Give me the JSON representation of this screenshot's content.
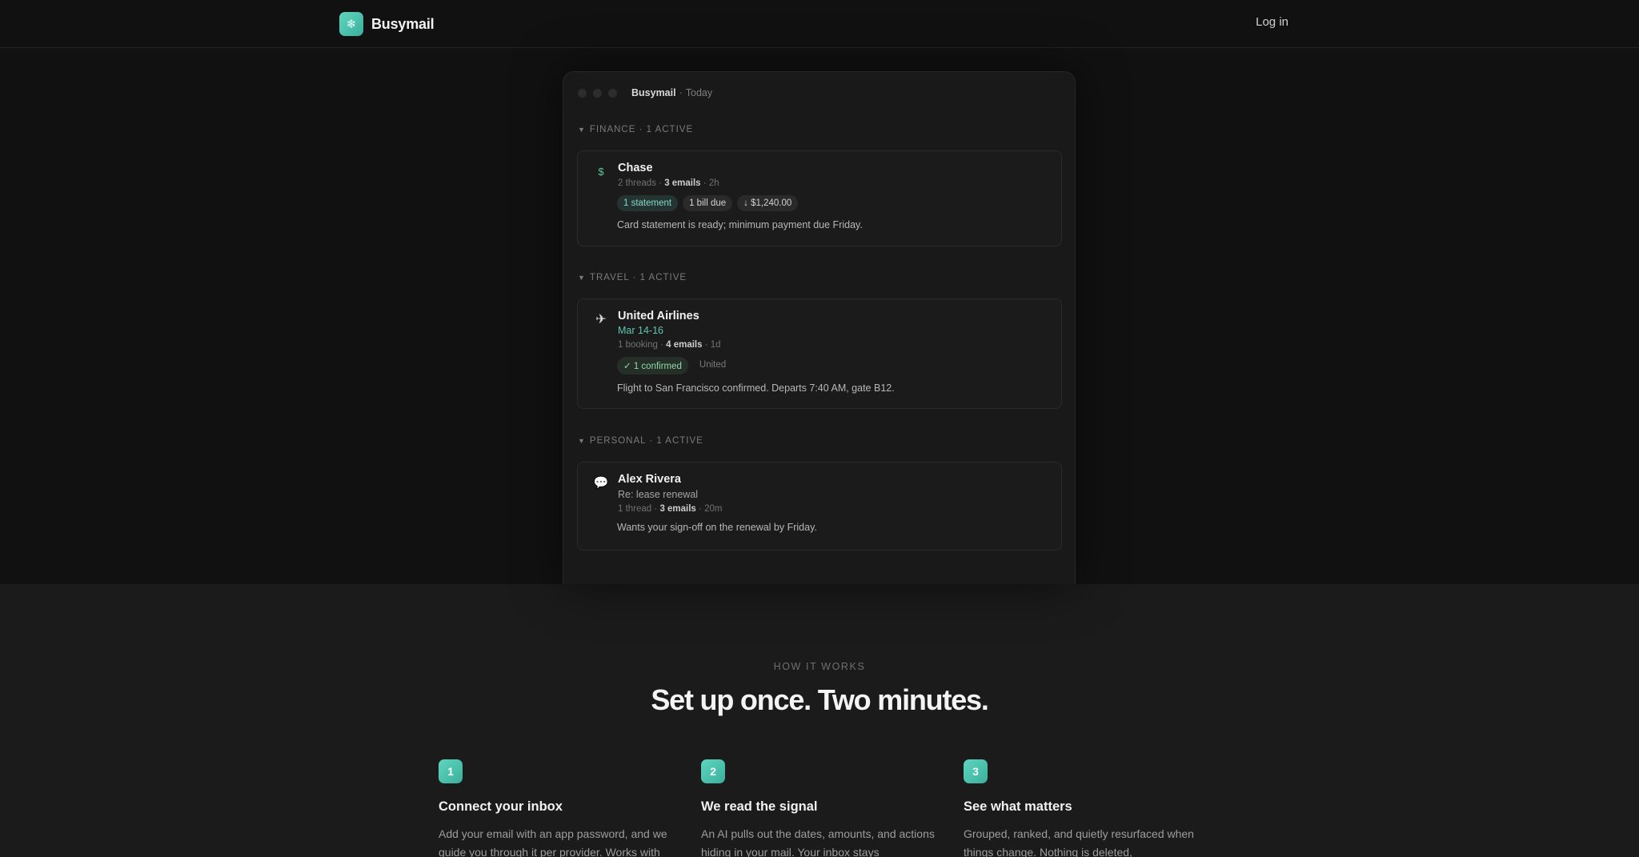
{
  "nav": {
    "brand": "Busymail",
    "login_label": "Log in"
  },
  "window": {
    "title": "Busymail",
    "separator": "·",
    "subtitle": "Today",
    "sections": [
      {
        "label": "Finance · 1 active",
        "card": {
          "icon": "dollar-icon",
          "name": "Chase",
          "meta_pre": "2 threads ·",
          "meta_bold": "3 emails",
          "meta_post": "· 2h",
          "chips": [
            "1 statement",
            "1 bill due",
            "↓ $1,240.00"
          ],
          "summary": "Card statement is ready; minimum payment due Friday."
        }
      },
      {
        "label": "Travel · 1 active",
        "card": {
          "icon": "airplane-icon",
          "name": "United Airlines",
          "date": "Mar 14-16",
          "meta_pre": "1 booking ·",
          "meta_bold": "4 emails",
          "meta_post": "· 1d",
          "chips": [
            "✓ 1 confirmed",
            "United"
          ],
          "summary": "Flight to San Francisco confirmed. Departs 7:40 AM, gate B12."
        }
      },
      {
        "label": "Personal · 1 active",
        "card": {
          "icon": "speech-bubble-icon",
          "name": "Alex Rivera",
          "subject": "Re: lease renewal",
          "meta_pre": "1 thread ·",
          "meta_bold": "3 emails",
          "meta_post": "· 20m",
          "summary": "Wants your sign-off on the renewal by Friday."
        }
      }
    ]
  },
  "how_it_works": {
    "eyebrow": "How it works",
    "title": "Set up once. Two minutes.",
    "steps": [
      {
        "number": "1",
        "title": "Connect your inbox",
        "description": "Add your email with an app password, and we guide you through it per provider. Works with"
      },
      {
        "number": "2",
        "title": "We read the signal",
        "description": "An AI pulls out the dates, amounts, and actions hiding in your mail. Your inbox stays"
      },
      {
        "number": "3",
        "title": "See what matters",
        "description": "Grouped, ranked, and quietly resurfaced when things change. Nothing is deleted,"
      }
    ]
  },
  "colors": {
    "accent": "#4cc7b0",
    "hero_bg": "#111111",
    "page_bg": "#1b1b1b"
  }
}
